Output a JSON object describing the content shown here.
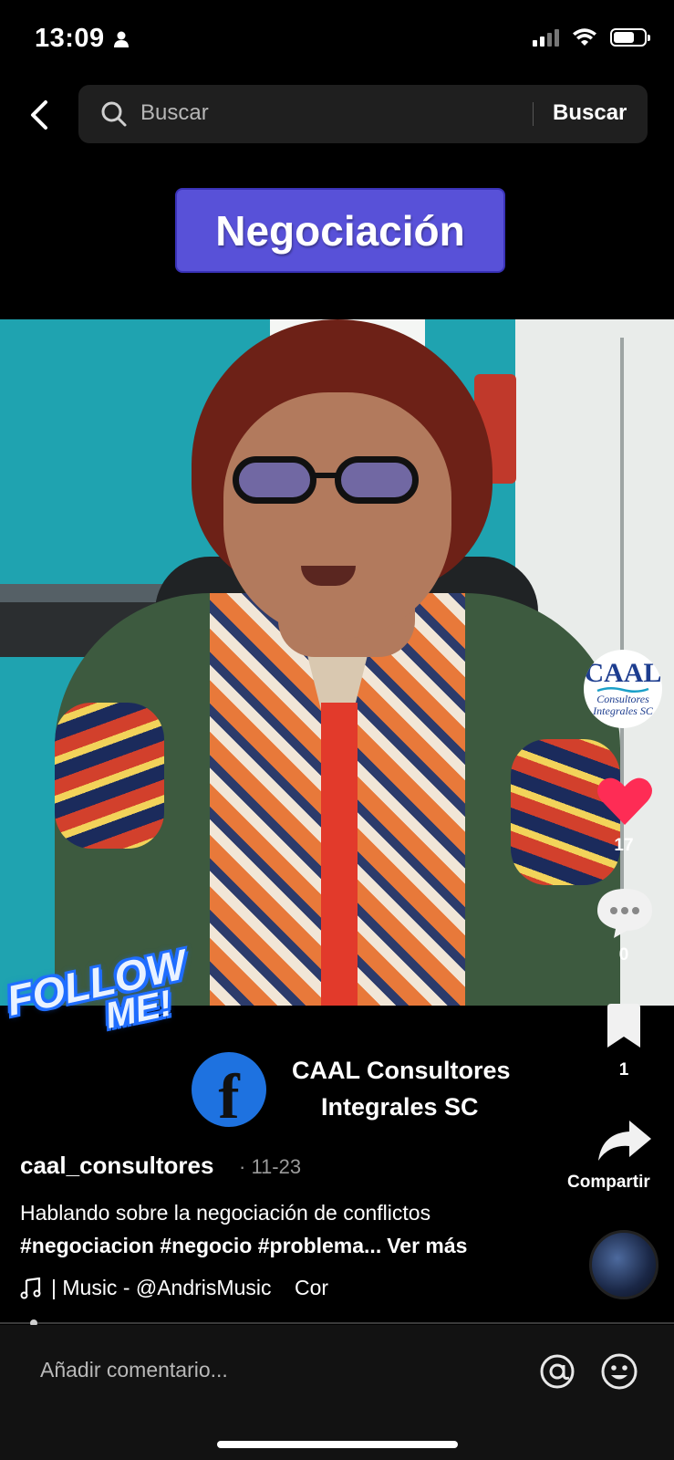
{
  "status_bar": {
    "time": "13:09",
    "battery_level": 0.7
  },
  "search": {
    "placeholder": "Buscar",
    "button_label": "Buscar"
  },
  "video": {
    "title_badge": "Negociación",
    "sticker_line1": "FOLLOW",
    "sticker_line2": "ME!",
    "page_name_line1": "CAAL Consultores",
    "page_name_line2": "Integrales SC"
  },
  "creator_avatar": {
    "logo_text": "CAAL",
    "logo_sub1": "Consultores",
    "logo_sub2": "Integrales SC"
  },
  "actions": {
    "like_count": "17",
    "comment_count": "0",
    "bookmark_count": "1",
    "share_label": "Compartir"
  },
  "caption": {
    "username": "caal_consultores",
    "date": "· 11-23",
    "description": "Hablando sobre la negociación de conflictos",
    "hashtags": "#negociacion #negocio #problema...",
    "see_more": "Ver más",
    "music": "| Music - @AndrisMusic    Cor"
  },
  "playback_progress": 0.045,
  "comment_bar": {
    "placeholder": "Añadir comentario..."
  },
  "colors": {
    "badge": "#5851d8",
    "like": "#fe2c55",
    "facebook": "#1e72e0"
  }
}
